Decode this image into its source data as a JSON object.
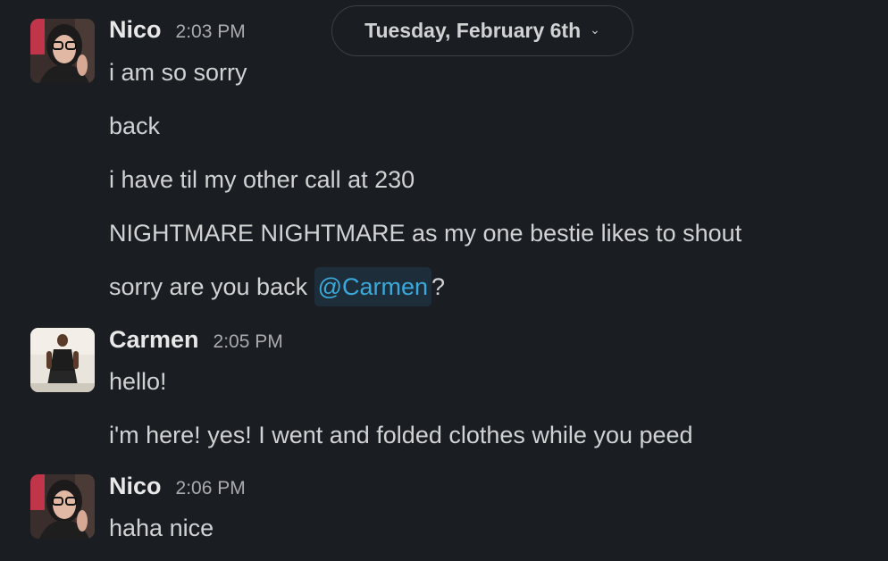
{
  "date_divider": {
    "label": "Tuesday, February 6th",
    "chevron_icon": "chevron-down-icon"
  },
  "groups": [
    {
      "sender": "Nico",
      "time": "2:03 PM",
      "messages": [
        "i am so sorry",
        "back",
        "i have til my other call at 230",
        "NIGHTMARE NIGHTMARE as my one bestie likes to shout",
        {
          "before": "sorry are you back ",
          "mention": "@Carmen",
          "after": "?"
        }
      ]
    },
    {
      "sender": "Carmen",
      "time": "2:05 PM",
      "messages": [
        "hello!",
        "i'm here! yes! I went and folded clothes while you peed"
      ]
    },
    {
      "sender": "Nico",
      "time": "2:06 PM",
      "messages": [
        "haha nice"
      ]
    }
  ],
  "colors": {
    "background": "#1a1d21",
    "text": "#d1d2d3",
    "mention_text": "#3ba9d9",
    "mention_bg": "#1e2d3a"
  }
}
